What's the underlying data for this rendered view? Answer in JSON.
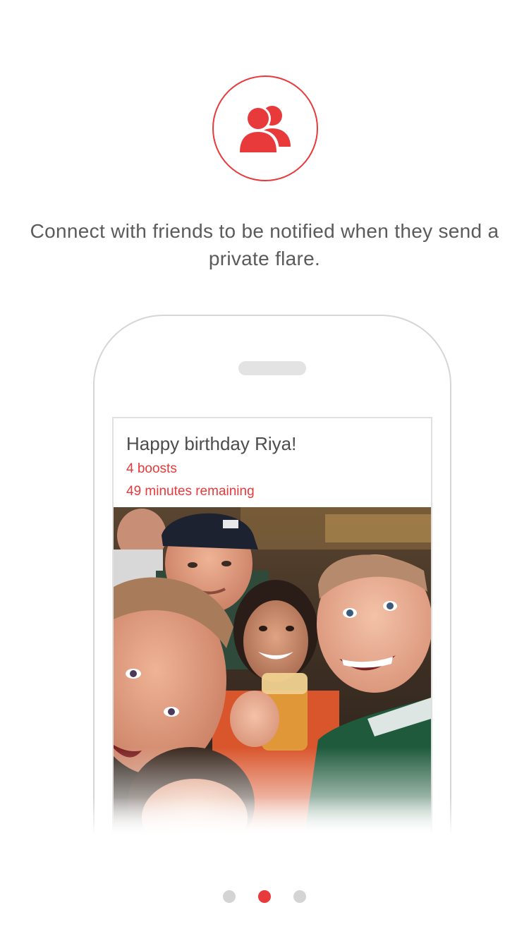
{
  "colors": {
    "accent": "#e8393b",
    "text": "#5b5b5b",
    "inactive_dot": "#d4d4d4",
    "phone_outline": "#d6d6d6"
  },
  "header": {
    "icon": "friends-group-icon"
  },
  "tagline": "Connect with friends to be notified when they send a private flare.",
  "flare": {
    "title": "Happy birthday Riya!",
    "boosts": "4 boosts",
    "time_remaining": "49 minutes remaining",
    "photo": "group-selfie-photo"
  },
  "pager": {
    "count": 3,
    "active_index": 1
  }
}
